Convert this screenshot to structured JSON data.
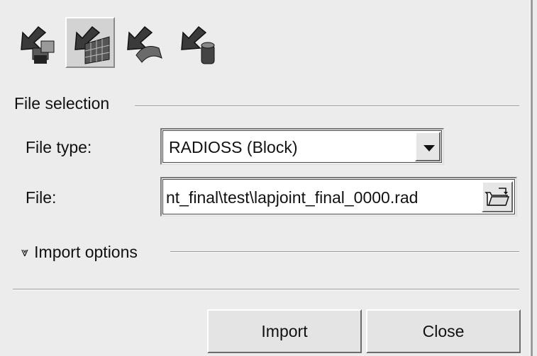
{
  "toolbar": {
    "tools": [
      {
        "icon": "import-model-icon",
        "selected": false
      },
      {
        "icon": "import-results-icon",
        "selected": true
      },
      {
        "icon": "import-geometry-icon",
        "selected": false
      },
      {
        "icon": "import-solver-deck-icon",
        "selected": false
      }
    ]
  },
  "file_selection": {
    "section_label": "File selection",
    "file_type_label": "File type:",
    "file_type_value": "RADIOSS (Block)",
    "file_label": "File:",
    "file_value": "nt_final\\test\\lapjoint_final_0000.rad"
  },
  "import_options": {
    "label": "Import options",
    "icon": "double-chevron-down-icon"
  },
  "actions": {
    "import_label": "Import",
    "close_label": "Close"
  }
}
